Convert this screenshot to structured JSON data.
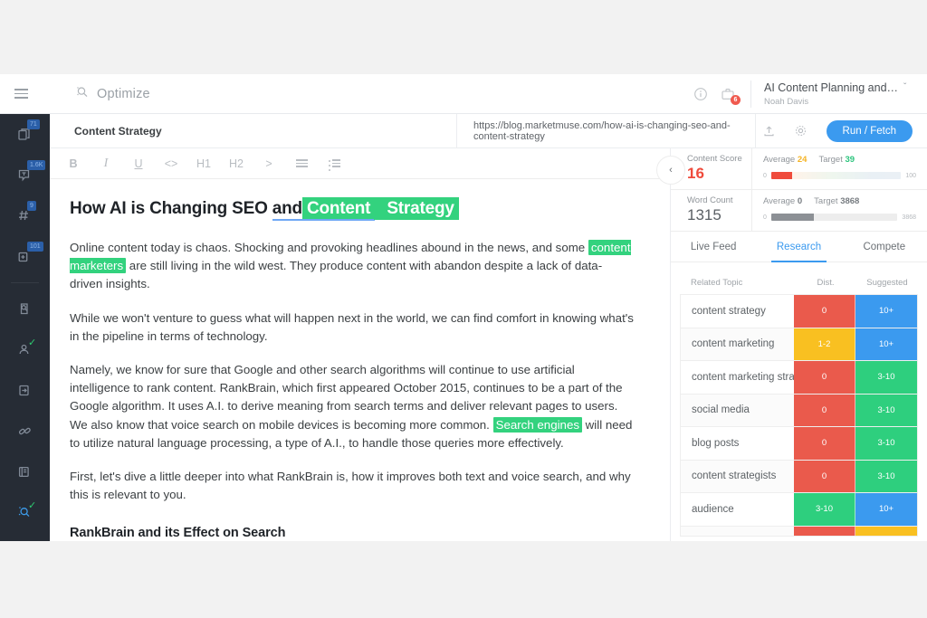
{
  "header": {
    "menu_icon": "hamburger-icon",
    "title": "Optimize",
    "title_icon": "optimize-magnifier-icon",
    "info_icon": "info-icon",
    "bag_icon": "briefcase-icon",
    "bag_badge": "6",
    "project_name": "AI Content Planning and Optim...",
    "project_user": "Noah Davis",
    "chevron": "ˇ"
  },
  "rail": {
    "items": [
      {
        "name": "pages-icon",
        "badge": "71",
        "check": false
      },
      {
        "name": "topics-icon",
        "badge": "1.6K",
        "check": false
      },
      {
        "name": "keywords-icon",
        "badge": "9",
        "check": false
      },
      {
        "name": "add-page-icon",
        "badge": "101",
        "check": false
      },
      {
        "name": "research-icon",
        "badge": "",
        "check": false
      },
      {
        "name": "audience-icon",
        "badge": "",
        "check": true
      },
      {
        "name": "inventory-icon",
        "badge": "",
        "check": false
      },
      {
        "name": "connect-icon",
        "badge": "",
        "check": false
      },
      {
        "name": "briefs-icon",
        "badge": "",
        "check": false
      },
      {
        "name": "optimize-icon",
        "badge": "",
        "check": true
      }
    ]
  },
  "docbar": {
    "doc_title": "Content Strategy",
    "url": "https://blog.marketmuse.com/how-ai-is-changing-seo-and-content-strategy",
    "upload_icon": "upload-icon",
    "settings_icon": "gear-icon",
    "run_label": "Run / Fetch"
  },
  "toolbar": {
    "items": [
      {
        "label": "B",
        "name": "bold-button",
        "cls": "bo"
      },
      {
        "label": "I",
        "name": "italic-button",
        "cls": "it"
      },
      {
        "label": "U",
        "name": "underline-button",
        "cls": "un"
      },
      {
        "label": "<>",
        "name": "code-button",
        "cls": ""
      },
      {
        "label": "H1",
        "name": "heading1-button",
        "cls": ""
      },
      {
        "label": "H2",
        "name": "heading2-button",
        "cls": ""
      },
      {
        "label": ">",
        "name": "more-button",
        "cls": ""
      }
    ],
    "align_icon": "align-left-icon",
    "list_icon": "bullet-list-icon"
  },
  "document": {
    "h1": {
      "plain1": "How AI is Changing SEO ",
      "underlined": "and",
      "hl1": "Content",
      "hl2": "Strategy"
    },
    "p1_a": "Online content today is chaos. Shocking and provoking headlines abound in the news, and some ",
    "p1_hl": "content marketers",
    "p1_b": " are still living in the wild west. They produce content with abandon despite a lack of data-driven insights.",
    "p2": "While we won't venture to guess what will happen next in the world, we can find comfort in knowing what's in the pipeline in terms of technology.",
    "p3_a": "Namely, we know for sure that Google and other search algorithms will continue to use artificial intelligence to rank content. RankBrain, which first appeared October 2015, continues to be a part of the Google algorithm. It uses A.I. to derive meaning from search terms and deliver relevant pages to users. We also know that voice search on mobile devices is becoming more common. ",
    "p3_hl": "Search engines",
    "p3_b": " will need to utilize natural language processing, a type of A.I., to handle those queries more effectively.",
    "p4": "First, let's dive a little deeper into what RankBrain is, how it improves both text and voice search, and why this is relevant to you.",
    "h2": "RankBrain and its Effect on Search"
  },
  "panel": {
    "collapse_icon": "chevron-left-icon",
    "content_score": {
      "label": "Content Score",
      "value": "16",
      "average_label": "Average",
      "average_value": "24",
      "target_label": "Target",
      "target_value": "39",
      "bar_min": "0",
      "bar_max": "100",
      "fill_percent": 16
    },
    "word_count": {
      "label": "Word Count",
      "value": "1315",
      "average_label": "Average",
      "average_value": "0",
      "target_label": "Target",
      "target_value": "3868",
      "bar_min": "0",
      "bar_max": "3868",
      "fill_percent": 34
    },
    "tabs": [
      {
        "label": "Live Feed",
        "active": false
      },
      {
        "label": "Research",
        "active": true
      },
      {
        "label": "Compete",
        "active": false
      }
    ],
    "table": {
      "columns": [
        "Related Topic",
        "Dist.",
        "Suggested"
      ],
      "rows": [
        {
          "topic": "content strategy",
          "dist": "0",
          "dist_color": "cl-red",
          "sugg": "10+",
          "sugg_color": "cl-blue"
        },
        {
          "topic": "content marketing",
          "dist": "1-2",
          "dist_color": "cl-yellow",
          "sugg": "10+",
          "sugg_color": "cl-blue"
        },
        {
          "topic": "content marketing stra...",
          "dist": "0",
          "dist_color": "cl-red",
          "sugg": "3-10",
          "sugg_color": "cl-green"
        },
        {
          "topic": "social media",
          "dist": "0",
          "dist_color": "cl-red",
          "sugg": "3-10",
          "sugg_color": "cl-green"
        },
        {
          "topic": "blog posts",
          "dist": "0",
          "dist_color": "cl-red",
          "sugg": "3-10",
          "sugg_color": "cl-green"
        },
        {
          "topic": "content strategists",
          "dist": "0",
          "dist_color": "cl-red",
          "sugg": "3-10",
          "sugg_color": "cl-green"
        },
        {
          "topic": "audience",
          "dist": "3-10",
          "dist_color": "cl-green",
          "sugg": "10+",
          "sugg_color": "cl-blue"
        },
        {
          "topic": "",
          "dist": "",
          "dist_color": "cl-red",
          "sugg": "",
          "sugg_color": "cl-yellow"
        }
      ]
    }
  },
  "colors": {
    "accent_blue": "#3b9aef",
    "highlight_green": "#33d27e",
    "danger_red": "#ef4b3c",
    "warn_yellow": "#f9c021",
    "rail_bg": "#262c35"
  }
}
